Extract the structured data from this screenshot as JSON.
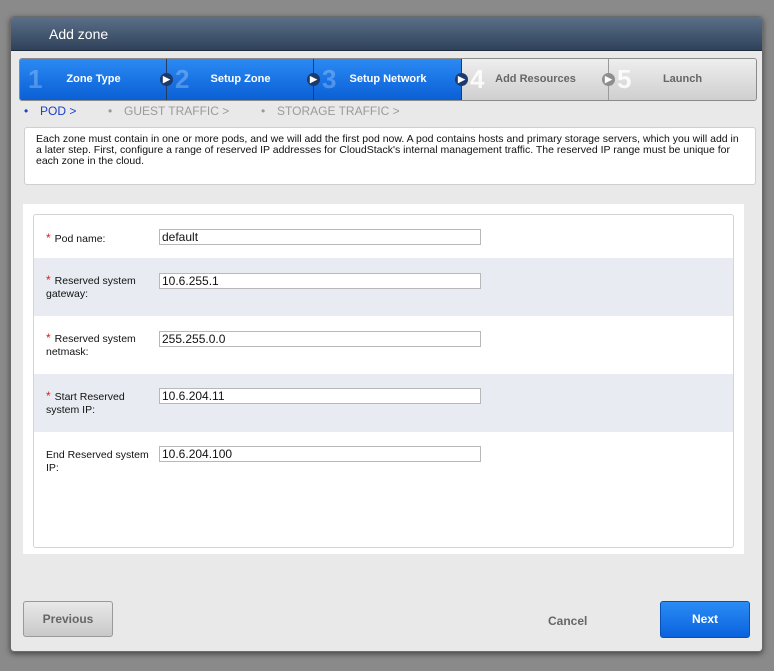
{
  "dialog": {
    "title": "Add zone"
  },
  "steps": [
    {
      "number": "1",
      "label": "Zone Type"
    },
    {
      "number": "2",
      "label": "Setup Zone"
    },
    {
      "number": "3",
      "label": "Setup Network"
    },
    {
      "number": "4",
      "label": "Add Resources"
    },
    {
      "number": "5",
      "label": "Launch"
    }
  ],
  "subnav": {
    "bullet": "•",
    "pod": "POD >",
    "guest": "GUEST TRAFFIC >",
    "storage": "STORAGE TRAFFIC >"
  },
  "description": "Each zone must contain in one or more pods, and we will add the first pod now. A pod contains hosts and primary storage servers, which you will add in a later step. First, configure a range of reserved IP addresses for CloudStack's internal management traffic. The reserved IP range must be unique for each zone in the cloud.",
  "form": {
    "required_mark": "*",
    "fields": [
      {
        "label": "Pod name:",
        "value": "default"
      },
      {
        "label": "Reserved system gateway:",
        "value": "10.6.255.1"
      },
      {
        "label": "Reserved system netmask:",
        "value": "255.255.0.0"
      },
      {
        "label": "Start Reserved system IP:",
        "value": "10.6.204.11"
      },
      {
        "label": "End Reserved system IP:",
        "value": "10.6.204.100"
      }
    ]
  },
  "buttons": {
    "previous": "Previous",
    "cancel": "Cancel",
    "next": "Next"
  },
  "colors": {
    "accent": "#0b62dd",
    "required": "#d42020",
    "title_bar": "#3e526c"
  }
}
